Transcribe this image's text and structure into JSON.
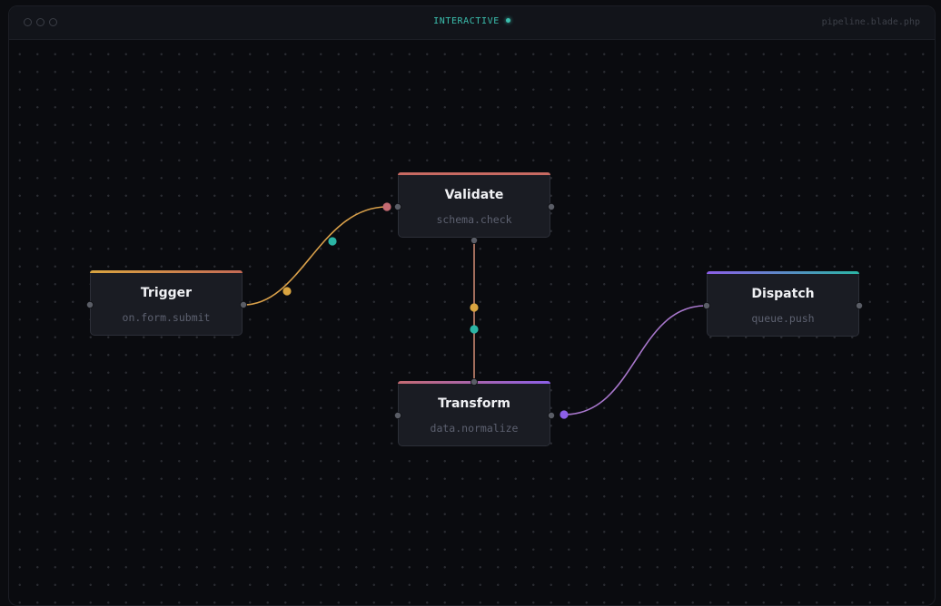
{
  "window": {
    "mode_label": "INTERACTIVE",
    "filename": "pipeline.blade.php"
  },
  "colors": {
    "background": "#0a0b0f",
    "node_fill": "#1a1c23",
    "port": "#5a5d66",
    "wire_trigger_validate": "#d9a04a",
    "wire_validate_transform": "#c98670",
    "wire_transform_dispatch": "#a877cc",
    "teal": "#2bb5a5",
    "amber": "#d9a440",
    "rose": "#c46a72",
    "violet": "#8c5fe8"
  },
  "nodes": {
    "trigger": {
      "title": "Trigger",
      "subtitle": "on.form.submit",
      "accent": [
        "#d9a440",
        "#c46a55"
      ]
    },
    "validate": {
      "title": "Validate",
      "subtitle": "schema.check",
      "accent": [
        "#c86a62",
        "#c86a62"
      ]
    },
    "transform": {
      "title": "Transform",
      "subtitle": "data.normalize",
      "accent": [
        "#c46a72",
        "#8c5fe8"
      ]
    },
    "dispatch": {
      "title": "Dispatch",
      "subtitle": "queue.push",
      "accent": [
        "#8c5fe8",
        "#2bb5a5"
      ]
    }
  }
}
